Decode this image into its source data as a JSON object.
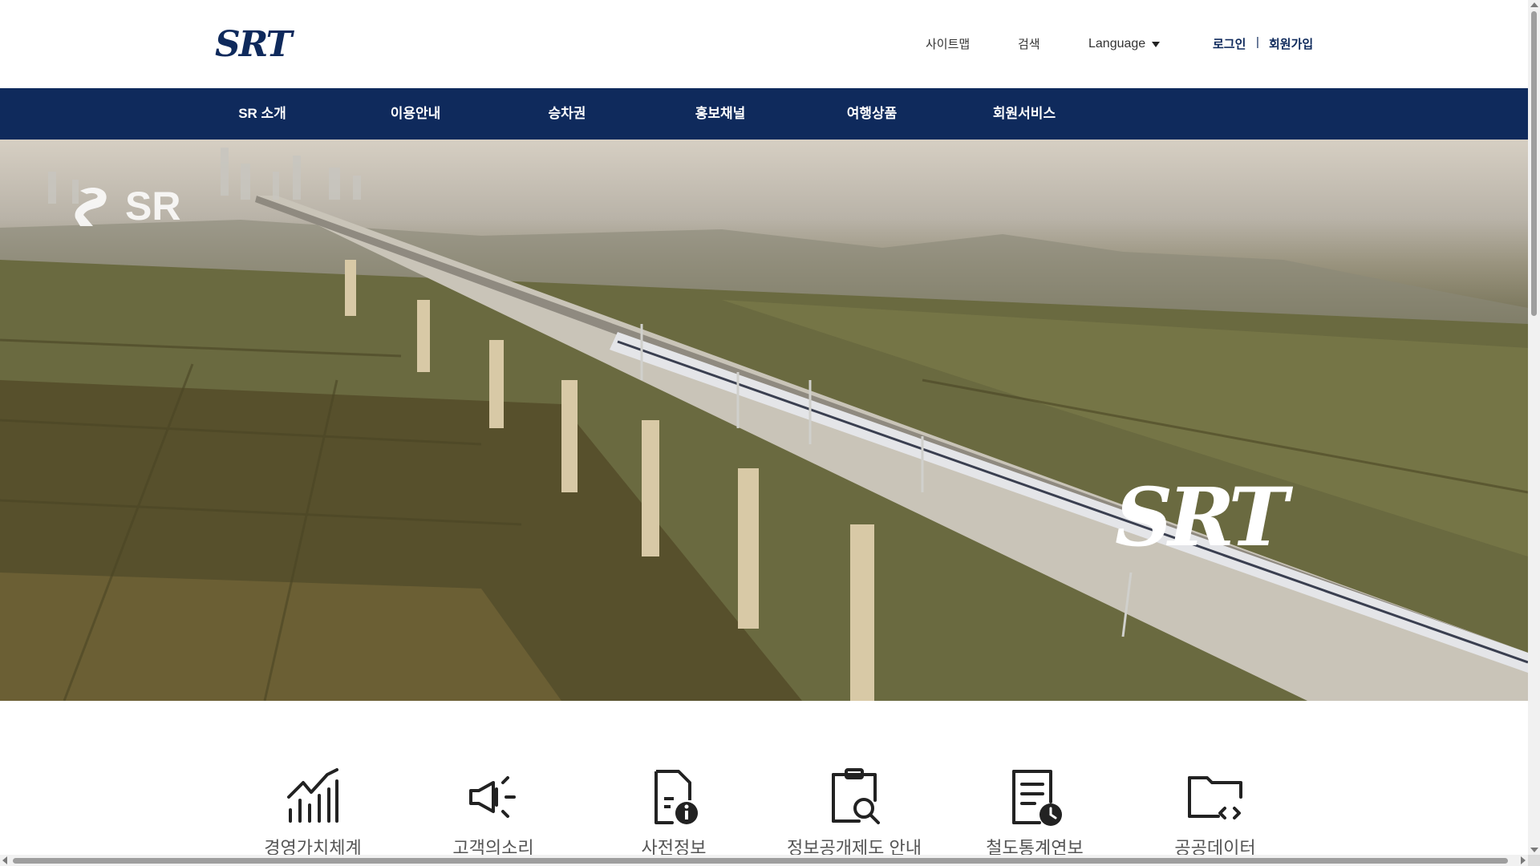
{
  "header": {
    "logo_text": "SRT",
    "util": {
      "sitemap": "사이트맵",
      "search": "검색",
      "language": "Language",
      "login": "로그인",
      "separator": "|",
      "join": "회원가입"
    }
  },
  "gnb": {
    "items": [
      {
        "label": "SR 소개"
      },
      {
        "label": "이용안내"
      },
      {
        "label": "승차권"
      },
      {
        "label": "홍보채널"
      },
      {
        "label": "여행상품"
      },
      {
        "label": "회원서비스"
      }
    ]
  },
  "hero": {
    "badge_text": "SR",
    "logo_text": "SRT"
  },
  "quick_menu": {
    "items": [
      {
        "label": "경영가치체계",
        "icon": "chart-growth-icon"
      },
      {
        "label": "고객의소리",
        "icon": "megaphone-icon"
      },
      {
        "label": "사전정보",
        "icon": "document-info-icon"
      },
      {
        "label": "정보공개제도 안내",
        "icon": "clipboard-search-icon"
      },
      {
        "label": "철도통계연보",
        "icon": "document-clock-icon"
      },
      {
        "label": "공공데이터",
        "icon": "folder-code-icon"
      }
    ]
  },
  "colors": {
    "brand_navy": "#0f2a5c",
    "quick_label": "#555555"
  }
}
